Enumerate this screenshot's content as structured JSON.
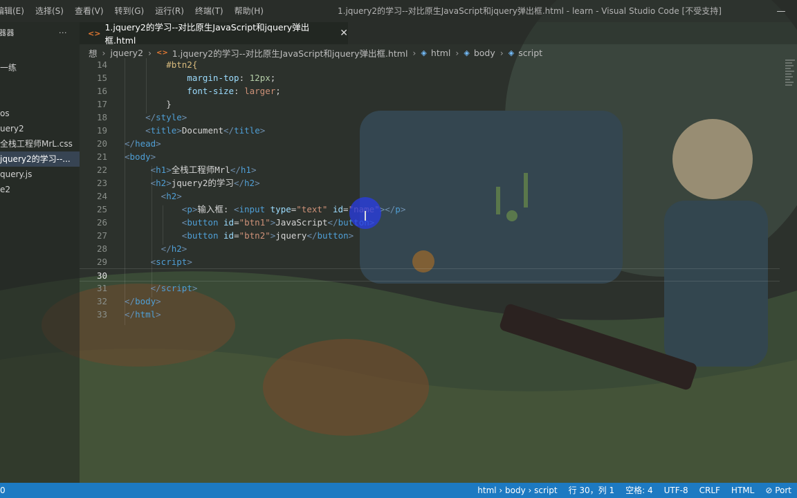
{
  "menu": [
    "编辑(E)",
    "选择(S)",
    "查看(V)",
    "转到(G)",
    "运行(R)",
    "终端(T)",
    "帮助(H)"
  ],
  "window_title": "1.jquery2的学习--对比原生JavaScript和jquery弹出框.html - learn - Visual Studio Code [不受支持]",
  "window_controls": {
    "minimize": "—"
  },
  "sidebar": {
    "title": "器器",
    "more": "···",
    "items": [
      {
        "label": "一练"
      },
      {
        "label": "os"
      },
      {
        "label": "uery2"
      },
      {
        "label": "全栈工程师MrL.css"
      },
      {
        "label": "jquery2的学习--..."
      },
      {
        "label": "query.js"
      },
      {
        "label": "e2"
      }
    ]
  },
  "tab": {
    "label": "1.jquery2的学习--对比原生JavaScript和jquery弹出框.html",
    "close": "✕"
  },
  "breadcrumb": {
    "root": "想",
    "folder": "jquery2",
    "file": "1.jquery2的学习--对比原生JavaScript和jquery弹出框.html",
    "html": "html",
    "body": "body",
    "script": "script"
  },
  "editor": {
    "lines": [
      {
        "n": "14",
        "tokens": [
          [
            "sel",
            "        #btn2{"
          ]
        ]
      },
      {
        "n": "15",
        "tokens": [
          [
            "prop",
            "            margin-top"
          ],
          [
            "text",
            ": "
          ],
          [
            "num",
            "12px"
          ],
          [
            "text",
            ";"
          ]
        ]
      },
      {
        "n": "16",
        "tokens": [
          [
            "prop",
            "            font-size"
          ],
          [
            "text",
            ": "
          ],
          [
            "val",
            "larger"
          ],
          [
            "text",
            ";"
          ]
        ]
      },
      {
        "n": "17",
        "tokens": [
          [
            "text",
            "        }"
          ]
        ]
      },
      {
        "n": "18",
        "tokens": [
          [
            "tag",
            "    </"
          ],
          [
            "name",
            "style"
          ],
          [
            "tag",
            ">"
          ]
        ]
      },
      {
        "n": "19",
        "tokens": [
          [
            "tag",
            "    <"
          ],
          [
            "name",
            "title"
          ],
          [
            "tag",
            ">"
          ],
          [
            "text",
            "Document"
          ],
          [
            "tag",
            "</"
          ],
          [
            "name",
            "title"
          ],
          [
            "tag",
            ">"
          ]
        ]
      },
      {
        "n": "20",
        "tokens": [
          [
            "tag",
            "</"
          ],
          [
            "name",
            "head"
          ],
          [
            "tag",
            ">"
          ]
        ]
      },
      {
        "n": "21",
        "tokens": [
          [
            "tag",
            "<"
          ],
          [
            "name",
            "body"
          ],
          [
            "tag",
            ">"
          ]
        ]
      },
      {
        "n": "22",
        "tokens": [
          [
            "tag",
            "     <"
          ],
          [
            "name",
            "h1"
          ],
          [
            "tag",
            ">"
          ],
          [
            "text",
            "全栈工程师Mrl"
          ],
          [
            "tag",
            "</"
          ],
          [
            "name",
            "h1"
          ],
          [
            "tag",
            ">"
          ]
        ]
      },
      {
        "n": "23",
        "tokens": [
          [
            "tag",
            "     <"
          ],
          [
            "name",
            "h2"
          ],
          [
            "tag",
            ">"
          ],
          [
            "text",
            "jquery2的学习"
          ],
          [
            "tag",
            "</"
          ],
          [
            "name",
            "h2"
          ],
          [
            "tag",
            ">"
          ]
        ]
      },
      {
        "n": "24",
        "tokens": [
          [
            "tag",
            "       <"
          ],
          [
            "name",
            "h2"
          ],
          [
            "tag",
            ">"
          ]
        ]
      },
      {
        "n": "25",
        "tokens": [
          [
            "tag",
            "           <"
          ],
          [
            "name",
            "p"
          ],
          [
            "tag",
            ">"
          ],
          [
            "text",
            "输入框: "
          ],
          [
            "tag",
            "<"
          ],
          [
            "name",
            "input"
          ],
          [
            "text",
            " "
          ],
          [
            "attr",
            "type"
          ],
          [
            "text",
            "="
          ],
          [
            "str",
            "\"text\""
          ],
          [
            "text",
            " "
          ],
          [
            "attr",
            "id"
          ],
          [
            "text",
            "="
          ],
          [
            "str",
            "\"name\""
          ],
          [
            "tag",
            "></"
          ],
          [
            "name",
            "p"
          ],
          [
            "tag",
            ">"
          ]
        ]
      },
      {
        "n": "26",
        "tokens": [
          [
            "tag",
            "           <"
          ],
          [
            "name",
            "button"
          ],
          [
            "text",
            " "
          ],
          [
            "attr",
            "id"
          ],
          [
            "text",
            "="
          ],
          [
            "str",
            "\"btn1\""
          ],
          [
            "tag",
            ">"
          ],
          [
            "text",
            "JavaScript"
          ],
          [
            "tag",
            "</"
          ],
          [
            "name",
            "button"
          ],
          [
            "tag",
            ">"
          ]
        ]
      },
      {
        "n": "27",
        "tokens": [
          [
            "tag",
            "           <"
          ],
          [
            "name",
            "button"
          ],
          [
            "text",
            " "
          ],
          [
            "attr",
            "id"
          ],
          [
            "text",
            "="
          ],
          [
            "str",
            "\"btn2\""
          ],
          [
            "tag",
            ">"
          ],
          [
            "text",
            "jquery"
          ],
          [
            "tag",
            "</"
          ],
          [
            "name",
            "button"
          ],
          [
            "tag",
            ">"
          ]
        ]
      },
      {
        "n": "28",
        "tokens": [
          [
            "tag",
            "       </"
          ],
          [
            "name",
            "h2"
          ],
          [
            "tag",
            ">"
          ]
        ]
      },
      {
        "n": "29",
        "tokens": [
          [
            "tag",
            "     <"
          ],
          [
            "name",
            "script"
          ],
          [
            "tag",
            ">"
          ]
        ]
      },
      {
        "n": "30",
        "tokens": [],
        "current": true
      },
      {
        "n": "31",
        "tokens": [
          [
            "tag",
            "     </"
          ],
          [
            "name",
            "script"
          ],
          [
            "tag",
            ">"
          ]
        ]
      },
      {
        "n": "32",
        "tokens": [
          [
            "tag",
            "</"
          ],
          [
            "name",
            "body"
          ],
          [
            "tag",
            ">"
          ]
        ]
      },
      {
        "n": "33",
        "tokens": [
          [
            "tag",
            "</"
          ],
          [
            "name",
            "html"
          ],
          [
            "tag",
            ">"
          ]
        ]
      }
    ]
  },
  "status": {
    "left": "0",
    "path": "html › body › script",
    "position": "行 30，列 1",
    "indent": "空格: 4",
    "encoding": "UTF-8",
    "eol": "CRLF",
    "language": "HTML",
    "port": "Port"
  },
  "colors": {
    "statusbar": "#1d7ac2",
    "tag": "#6f8fae",
    "attr": "#9cdcfe",
    "string": "#ce9178",
    "selector": "#d7ba7d"
  }
}
